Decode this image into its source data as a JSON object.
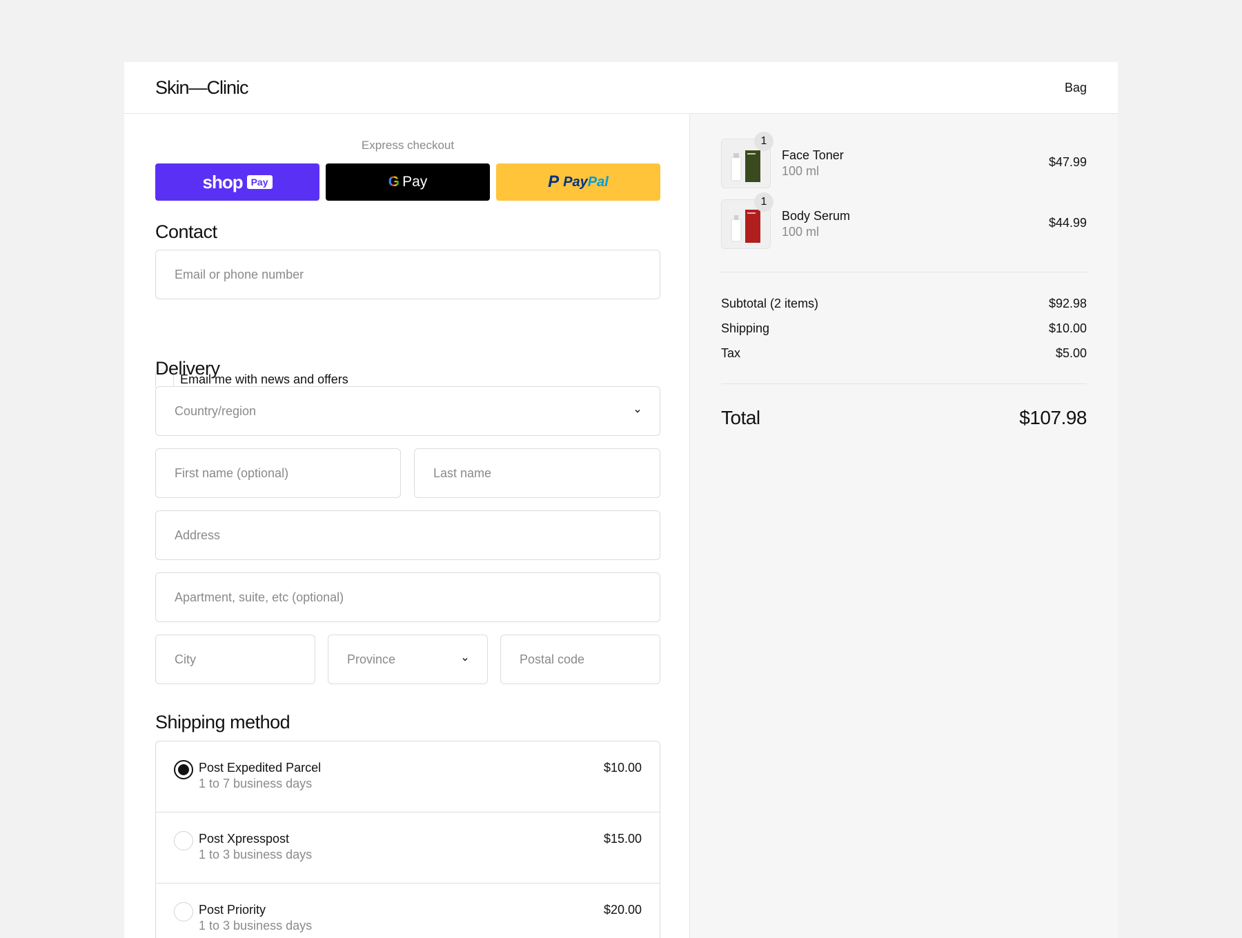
{
  "header": {
    "brand": "Skin—Clinic",
    "bag_label": "Bag"
  },
  "express": {
    "title": "Express checkout",
    "shop_pay": {
      "word": "shop",
      "badge": "Pay",
      "color": "#5a31f4"
    },
    "google_pay": {
      "g": "G",
      "word": "Pay",
      "color": "#000000"
    },
    "paypal": {
      "p": "P",
      "word1": "Pay",
      "word2": "Pal",
      "color": "#ffc439"
    }
  },
  "contact": {
    "title": "Contact",
    "email_placeholder": "Email or phone number",
    "newsletter_label": "Email me with news and offers"
  },
  "delivery": {
    "title": "Delivery",
    "country_placeholder": "Country/region",
    "first_name_placeholder": "First name (optional)",
    "last_name_placeholder": "Last name",
    "address_placeholder": "Address",
    "apartment_placeholder": "Apartment, suite, etc (optional)",
    "city_placeholder": "City",
    "province_placeholder": "Province",
    "postal_placeholder": "Postal code"
  },
  "shipping_method": {
    "title": "Shipping method",
    "options": [
      {
        "name": "Post Expedited Parcel",
        "time": "1 to 7 business days",
        "price": "$10.00",
        "selected": true
      },
      {
        "name": "Post Xpresspost",
        "time": "1 to 3 business days",
        "price": "$15.00",
        "selected": false
      },
      {
        "name": "Post Priority",
        "time": "1 to 3 business days",
        "price": "$20.00",
        "selected": false
      }
    ]
  },
  "cart": {
    "items": [
      {
        "qty": "1",
        "name": "Face Toner",
        "size": "100 ml",
        "price": "$47.99",
        "box_color": "#3b4a1e"
      },
      {
        "qty": "1",
        "name": "Body Serum",
        "size": "100 ml",
        "price": "$44.99",
        "box_color": "#b01e1e"
      }
    ],
    "subtotal_label": "Subtotal (2 items)",
    "subtotal": "$92.98",
    "shipping_label": "Shipping",
    "shipping": "$10.00",
    "tax_label": "Tax",
    "tax": "$5.00",
    "total_label": "Total",
    "total": "$107.98"
  }
}
